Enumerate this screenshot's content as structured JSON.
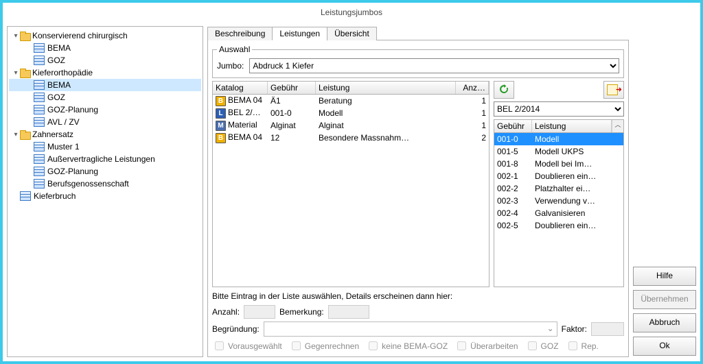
{
  "title": "Leistungsjumbos",
  "tree": [
    {
      "t": "folder",
      "label": "Konservierend chirurgisch",
      "d": 0,
      "open": true
    },
    {
      "t": "table",
      "label": "BEMA",
      "d": 1
    },
    {
      "t": "table",
      "label": "GOZ",
      "d": 1
    },
    {
      "t": "folder",
      "label": "Kieferorthopädie",
      "d": 0,
      "open": true
    },
    {
      "t": "table",
      "label": "BEMA",
      "d": 1,
      "selected": true
    },
    {
      "t": "table",
      "label": "GOZ",
      "d": 1
    },
    {
      "t": "table",
      "label": "GOZ-Planung",
      "d": 1
    },
    {
      "t": "table",
      "label": "AVL / ZV",
      "d": 1
    },
    {
      "t": "folder",
      "label": "Zahnersatz",
      "d": 0,
      "open": true
    },
    {
      "t": "table",
      "label": "Muster 1",
      "d": 1
    },
    {
      "t": "table",
      "label": "Außervertragliche Leistungen",
      "d": 1
    },
    {
      "t": "table",
      "label": "GOZ-Planung",
      "d": 1
    },
    {
      "t": "table",
      "label": "Berufsgenossenschaft",
      "d": 1
    },
    {
      "t": "table",
      "label": "Kieferbruch",
      "d": 0
    }
  ],
  "tabs": [
    "Beschreibung",
    "Leistungen",
    "Übersicht"
  ],
  "active_tab": 1,
  "auswahl": {
    "legend": "Auswahl",
    "label": "Jumbo:",
    "value": "Abdruck 1 Kiefer"
  },
  "left_grid": {
    "headers": [
      "Katalog",
      "Gebühr",
      "Leistung",
      "Anz…"
    ],
    "rows": [
      {
        "badge": "B",
        "katalog": "BEMA 04",
        "gebuehr": "Ä1",
        "leistung": "Beratung",
        "anz": "1"
      },
      {
        "badge": "L",
        "katalog": "BEL 2/…",
        "gebuehr": "001-0",
        "leistung": "Modell",
        "anz": "1"
      },
      {
        "badge": "M",
        "katalog": "Material",
        "gebuehr": "Alginat",
        "leistung": "Alginat",
        "anz": "1"
      },
      {
        "badge": "B",
        "katalog": "BEMA 04",
        "gebuehr": "12",
        "leistung": "Besondere Massnahm…",
        "anz": "2"
      }
    ]
  },
  "side": {
    "catalog": "BEL 2/2014",
    "headers": [
      "Gebühr",
      "Leistung"
    ],
    "rows": [
      {
        "g": "001-0",
        "l": "Modell",
        "sel": true
      },
      {
        "g": "001-5",
        "l": "Modell UKPS"
      },
      {
        "g": "001-8",
        "l": "Modell bei Im…"
      },
      {
        "g": "002-1",
        "l": "Doublieren ein…"
      },
      {
        "g": "002-2",
        "l": "Platzhalter ei…"
      },
      {
        "g": "002-3",
        "l": "Verwendung v…"
      },
      {
        "g": "002-4",
        "l": "Galvanisieren"
      },
      {
        "g": "002-5",
        "l": "Doublieren ein…"
      }
    ]
  },
  "hint": "Bitte Eintrag in der Liste auswählen, Details erscheinen dann hier:",
  "details": {
    "anzahl": "Anzahl:",
    "bemerkung": "Bemerkung:",
    "begruendung": "Begründung:",
    "faktor": "Faktor:",
    "checks": [
      "Vorausgewählt",
      "Gegenrechnen",
      "keine BEMA-GOZ",
      "Überarbeiten",
      "GOZ",
      "Rep."
    ]
  },
  "buttons": {
    "hilfe": "Hilfe",
    "uebernehmen": "Übernehmen",
    "abbruch": "Abbruch",
    "ok": "Ok"
  }
}
